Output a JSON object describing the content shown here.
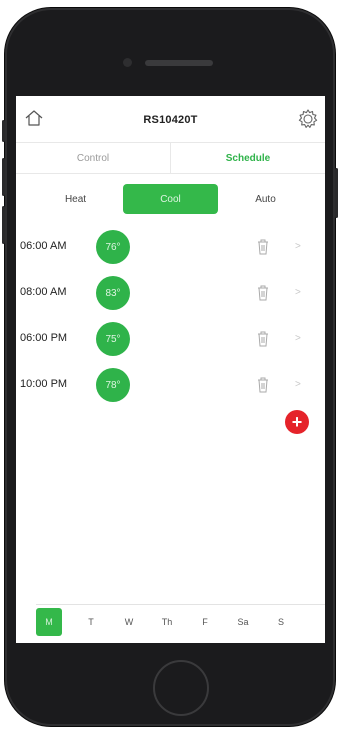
{
  "header": {
    "device_name": "RS10420T",
    "home_icon": "home-icon",
    "settings_icon": "gear-icon"
  },
  "tabs": [
    {
      "label": "Control",
      "active": false
    },
    {
      "label": "Schedule",
      "active": true
    }
  ],
  "modes": [
    {
      "label": "Heat",
      "active": false
    },
    {
      "label": "Cool",
      "active": true
    },
    {
      "label": "Auto",
      "active": false
    }
  ],
  "schedule": [
    {
      "time": "06:00 AM",
      "temp": "76°"
    },
    {
      "time": "08:00 AM",
      "temp": "83°"
    },
    {
      "time": "06:00 PM",
      "temp": "75°"
    },
    {
      "time": "10:00 PM",
      "temp": "78°"
    }
  ],
  "add_label": "+",
  "chevron": ">",
  "days": [
    {
      "label": "M",
      "active": true
    },
    {
      "label": "T",
      "active": false
    },
    {
      "label": "W",
      "active": false
    },
    {
      "label": "Th",
      "active": false
    },
    {
      "label": "F",
      "active": false
    },
    {
      "label": "Sa",
      "active": false
    },
    {
      "label": "S",
      "active": false
    }
  ],
  "colors": {
    "accent": "#34b84a",
    "add": "#e5232a",
    "phone": "#1b1b1d"
  }
}
